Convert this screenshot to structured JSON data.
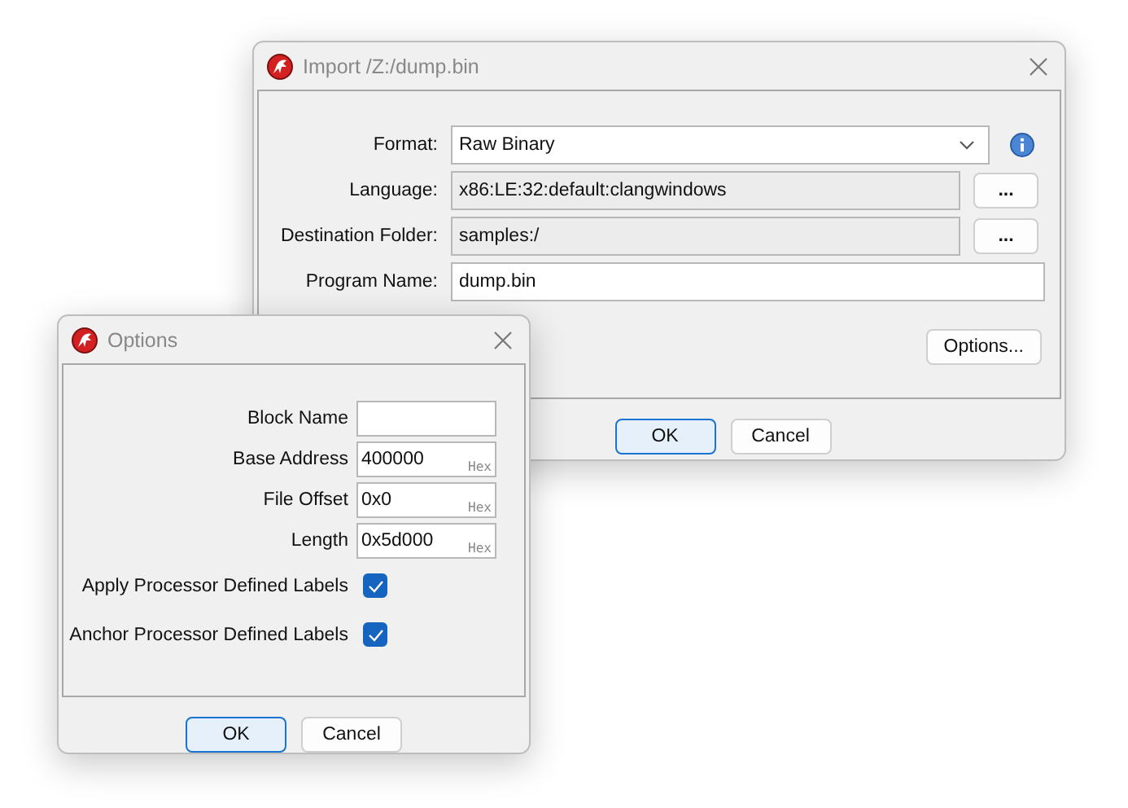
{
  "import_window": {
    "title": "Import /Z:/dump.bin",
    "fields": [
      {
        "kind": "dropdown",
        "label": "Format:",
        "value": "Raw Binary"
      },
      {
        "kind": "readonly",
        "label": "Language:",
        "value": "x86:LE:32:default:clangwindows",
        "button": "..."
      },
      {
        "kind": "readonly",
        "label": "Destination Folder:",
        "value": "samples:/",
        "button": "..."
      },
      {
        "kind": "text",
        "label": "Program Name:",
        "value": "dump.bin"
      }
    ],
    "options_button": "Options...",
    "buttons": [
      {
        "label": "OK",
        "selected": true
      },
      {
        "label": "Cancel",
        "selected": false
      }
    ]
  },
  "options_window": {
    "title": "Options",
    "fields": [
      {
        "kind": "text",
        "label": "Block Name"
      },
      {
        "kind": "hex",
        "label": "Base Address",
        "value": "400000",
        "suffix": "Hex"
      },
      {
        "kind": "hex",
        "label": "File Offset",
        "value": "0x0",
        "suffix": "Hex"
      },
      {
        "kind": "hex",
        "label": "Length",
        "value": "0x5d000",
        "suffix": "Hex"
      },
      {
        "kind": "checkbox",
        "label": "Apply Processor Defined Labels",
        "checked": true
      },
      {
        "kind": "checkbox",
        "label": "Anchor Processor Defined Labels",
        "checked": true
      }
    ],
    "buttons": [
      {
        "label": "OK",
        "selected": true
      },
      {
        "label": "Cancel",
        "selected": false
      }
    ]
  }
}
